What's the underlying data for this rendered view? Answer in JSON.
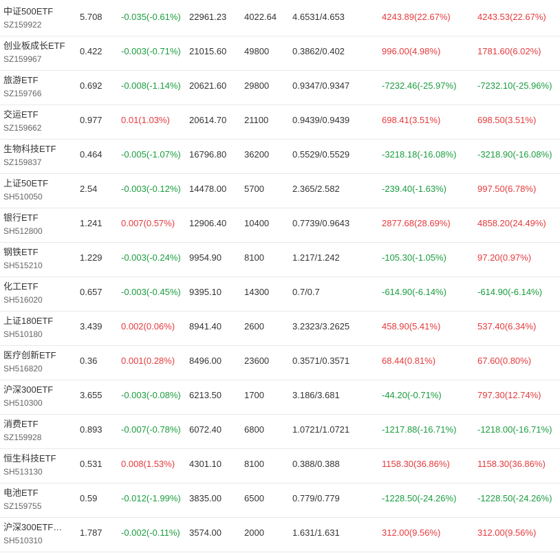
{
  "colors": {
    "up": "#e4393c",
    "down": "#1a9c3e",
    "text": "#333333",
    "subtext": "#666666",
    "divider": "#e8e8e8"
  },
  "rows": [
    {
      "name": "中证500ETF",
      "code": "SZ159922",
      "price": "5.708",
      "change": "-0.035(-0.61%)",
      "change_dir": "down",
      "market_value": "22961.23",
      "shares": "4022.64",
      "cost": "4.6531/4.653",
      "pl1": "4243.89(22.67%)",
      "pl1_dir": "up",
      "pl2": "4243.53(22.67%)",
      "pl2_dir": "up"
    },
    {
      "name": "创业板成长ETF",
      "code": "SZ159967",
      "price": "0.422",
      "change": "-0.003(-0.71%)",
      "change_dir": "down",
      "market_value": "21015.60",
      "shares": "49800",
      "cost": "0.3862/0.402",
      "pl1": "996.00(4.98%)",
      "pl1_dir": "up",
      "pl2": "1781.60(6.02%)",
      "pl2_dir": "up"
    },
    {
      "name": "旅游ETF",
      "code": "SZ159766",
      "price": "0.692",
      "change": "-0.008(-1.14%)",
      "change_dir": "down",
      "market_value": "20621.60",
      "shares": "29800",
      "cost": "0.9347/0.9347",
      "pl1": "-7232.46(-25.97%)",
      "pl1_dir": "down",
      "pl2": "-7232.10(-25.96%)",
      "pl2_dir": "down"
    },
    {
      "name": "交运ETF",
      "code": "SZ159662",
      "price": "0.977",
      "change": "0.01(1.03%)",
      "change_dir": "up",
      "market_value": "20614.70",
      "shares": "21100",
      "cost": "0.9439/0.9439",
      "pl1": "698.41(3.51%)",
      "pl1_dir": "up",
      "pl2": "698.50(3.51%)",
      "pl2_dir": "up"
    },
    {
      "name": "生物科技ETF",
      "code": "SZ159837",
      "price": "0.464",
      "change": "-0.005(-1.07%)",
      "change_dir": "down",
      "market_value": "16796.80",
      "shares": "36200",
      "cost": "0.5529/0.5529",
      "pl1": "-3218.18(-16.08%)",
      "pl1_dir": "down",
      "pl2": "-3218.90(-16.08%)",
      "pl2_dir": "down"
    },
    {
      "name": "上证50ETF",
      "code": "SH510050",
      "price": "2.54",
      "change": "-0.003(-0.12%)",
      "change_dir": "down",
      "market_value": "14478.00",
      "shares": "5700",
      "cost": "2.365/2.582",
      "pl1": "-239.40(-1.63%)",
      "pl1_dir": "down",
      "pl2": "997.50(6.78%)",
      "pl2_dir": "up"
    },
    {
      "name": "银行ETF",
      "code": "SH512800",
      "price": "1.241",
      "change": "0.007(0.57%)",
      "change_dir": "up",
      "market_value": "12906.40",
      "shares": "10400",
      "cost": "0.7739/0.9643",
      "pl1": "2877.68(28.69%)",
      "pl1_dir": "up",
      "pl2": "4858.20(24.49%)",
      "pl2_dir": "up"
    },
    {
      "name": "钢铁ETF",
      "code": "SH515210",
      "price": "1.229",
      "change": "-0.003(-0.24%)",
      "change_dir": "down",
      "market_value": "9954.90",
      "shares": "8100",
      "cost": "1.217/1.242",
      "pl1": "-105.30(-1.05%)",
      "pl1_dir": "down",
      "pl2": "97.20(0.97%)",
      "pl2_dir": "up"
    },
    {
      "name": "化工ETF",
      "code": "SH516020",
      "price": "0.657",
      "change": "-0.003(-0.45%)",
      "change_dir": "down",
      "market_value": "9395.10",
      "shares": "14300",
      "cost": "0.7/0.7",
      "pl1": "-614.90(-6.14%)",
      "pl1_dir": "down",
      "pl2": "-614.90(-6.14%)",
      "pl2_dir": "down"
    },
    {
      "name": "上证180ETF",
      "code": "SH510180",
      "price": "3.439",
      "change": "0.002(0.06%)",
      "change_dir": "up",
      "market_value": "8941.40",
      "shares": "2600",
      "cost": "3.2323/3.2625",
      "pl1": "458.90(5.41%)",
      "pl1_dir": "up",
      "pl2": "537.40(6.34%)",
      "pl2_dir": "up"
    },
    {
      "name": "医疗创新ETF",
      "code": "SH516820",
      "price": "0.36",
      "change": "0.001(0.28%)",
      "change_dir": "up",
      "market_value": "8496.00",
      "shares": "23600",
      "cost": "0.3571/0.3571",
      "pl1": "68.44(0.81%)",
      "pl1_dir": "up",
      "pl2": "67.60(0.80%)",
      "pl2_dir": "up"
    },
    {
      "name": "沪深300ETF",
      "code": "SH510300",
      "price": "3.655",
      "change": "-0.003(-0.08%)",
      "change_dir": "down",
      "market_value": "6213.50",
      "shares": "1700",
      "cost": "3.186/3.681",
      "pl1": "-44.20(-0.71%)",
      "pl1_dir": "down",
      "pl2": "797.30(12.74%)",
      "pl2_dir": "up"
    },
    {
      "name": "消费ETF",
      "code": "SZ159928",
      "price": "0.893",
      "change": "-0.007(-0.78%)",
      "change_dir": "down",
      "market_value": "6072.40",
      "shares": "6800",
      "cost": "1.0721/1.0721",
      "pl1": "-1217.88(-16.71%)",
      "pl1_dir": "down",
      "pl2": "-1218.00(-16.71%)",
      "pl2_dir": "down"
    },
    {
      "name": "恒生科技ETF",
      "code": "SH513130",
      "price": "0.531",
      "change": "0.008(1.53%)",
      "change_dir": "up",
      "market_value": "4301.10",
      "shares": "8100",
      "cost": "0.388/0.388",
      "pl1": "1158.30(36.86%)",
      "pl1_dir": "up",
      "pl2": "1158.30(36.86%)",
      "pl2_dir": "up"
    },
    {
      "name": "电池ETF",
      "code": "SZ159755",
      "price": "0.59",
      "change": "-0.012(-1.99%)",
      "change_dir": "down",
      "market_value": "3835.00",
      "shares": "6500",
      "cost": "0.779/0.779",
      "pl1": "-1228.50(-24.26%)",
      "pl1_dir": "down",
      "pl2": "-1228.50(-24.26%)",
      "pl2_dir": "down"
    },
    {
      "name": "沪深300ETF…",
      "code": "SH510310",
      "price": "1.787",
      "change": "-0.002(-0.11%)",
      "change_dir": "down",
      "market_value": "3574.00",
      "shares": "2000",
      "cost": "1.631/1.631",
      "pl1": "312.00(9.56%)",
      "pl1_dir": "up",
      "pl2": "312.00(9.56%)",
      "pl2_dir": "up"
    }
  ]
}
